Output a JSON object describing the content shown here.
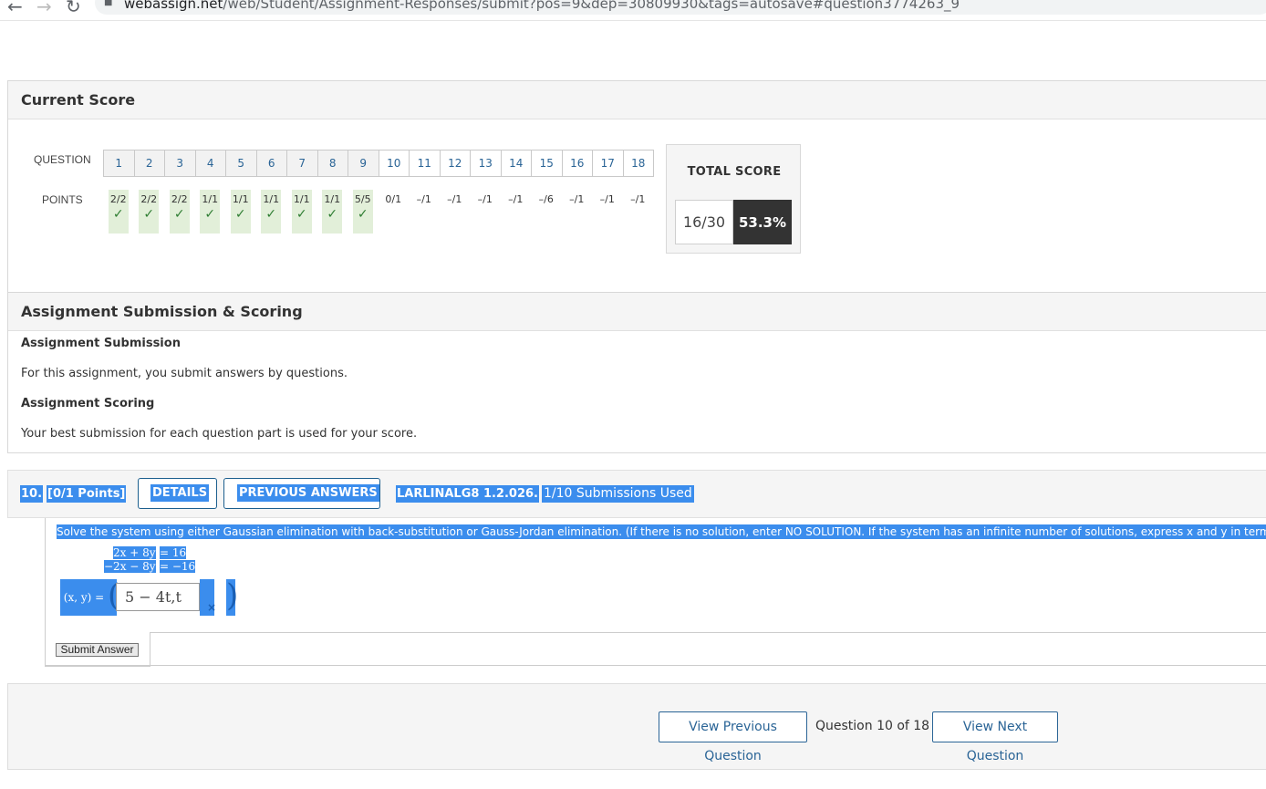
{
  "browser": {
    "back_glyph": "←",
    "forward_glyph": "→",
    "reload_glyph": "↻",
    "url_host": "webassign.net",
    "url_path": "/web/Student/Assignment-Responses/submit?pos=9&dep=30809930&tags=autosave#question3774263_9"
  },
  "current_score": {
    "heading": "Current Score",
    "question_label": "QUESTION",
    "points_label": "POINTS",
    "questions": [
      "1",
      "2",
      "3",
      "4",
      "5",
      "6",
      "7",
      "8",
      "9",
      "10",
      "11",
      "12",
      "13",
      "14",
      "15",
      "16",
      "17",
      "18"
    ],
    "points": [
      "2/2",
      "2/2",
      "2/2",
      "1/1",
      "1/1",
      "1/1",
      "1/1",
      "1/1",
      "5/5",
      "0/1",
      "–/1",
      "–/1",
      "–/1",
      "–/1",
      "–/6",
      "–/1",
      "–/1",
      "–/1"
    ],
    "correct_count": 9,
    "check_glyph": "✓",
    "total_label": "TOTAL SCORE",
    "total_fraction": "16/30",
    "total_percent": "53.3%"
  },
  "submission": {
    "heading": "Assignment Submission & Scoring",
    "submission_title": "Assignment Submission",
    "submission_text": "For this assignment, you submit answers by questions.",
    "scoring_title": "Assignment Scoring",
    "scoring_text": "Your best submission for each question part is used for your score."
  },
  "question": {
    "number": "10.",
    "points": "[0/1 Points]",
    "details_button": "DETAILS",
    "previous_answers_button": "PREVIOUS ANSWERS",
    "reference": "LARLINALG8 1.2.026.",
    "submissions": "1/10 Submissions Used",
    "prompt": "Solve the system using either Gaussian elimination with back-substitution or Gauss-Jordan elimination. (If there is no solution, enter NO SOLUTION. If the system has an infinite number of solutions, express x and y in terms",
    "eq1_lhs": "2x + 8y",
    "eq1_rhs": "= 16",
    "eq2_lhs": "−2x − 8y",
    "eq2_rhs": "= −16",
    "answer_label": "(x, y) =",
    "answer_value": "5 − 4t,t",
    "clear_glyph": "×",
    "submit_button": "Submit Answer"
  },
  "footer": {
    "prev_button": "View Previous Question",
    "position": "Question 10 of 18",
    "next_button": "View Next Question"
  },
  "colors": {
    "selection": "#3b8ded",
    "correct_bg": "#e2efd9",
    "link_blue": "#2a6496",
    "percent_bg": "#333333"
  }
}
